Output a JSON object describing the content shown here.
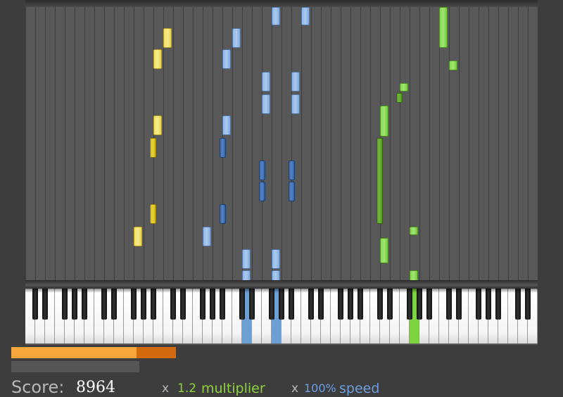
{
  "colors": {
    "track_yellow": "#f2e06a",
    "track_blue": "#8fb6e4",
    "track_green": "#84d850",
    "progress": "#f7a63c",
    "progress_track": "#d26a10",
    "multiplier_text": "#8fd23c",
    "speed_text": "#6e9ee0"
  },
  "keyboard": {
    "pressed_white_keys": [
      {
        "key_index": 22,
        "color": "blue"
      },
      {
        "key_index": 25,
        "color": "blue"
      },
      {
        "key_index": 39,
        "color": "green"
      }
    ]
  },
  "progress": {
    "played_fraction": 0.76
  },
  "hud": {
    "score_label": "Score:",
    "score_value": "8964",
    "multiplier_prefix": "x",
    "multiplier_value": "1.2",
    "multiplier_label": "multiplier",
    "speed_prefix": "x",
    "speed_value": "100%",
    "speed_label": "speed"
  }
}
